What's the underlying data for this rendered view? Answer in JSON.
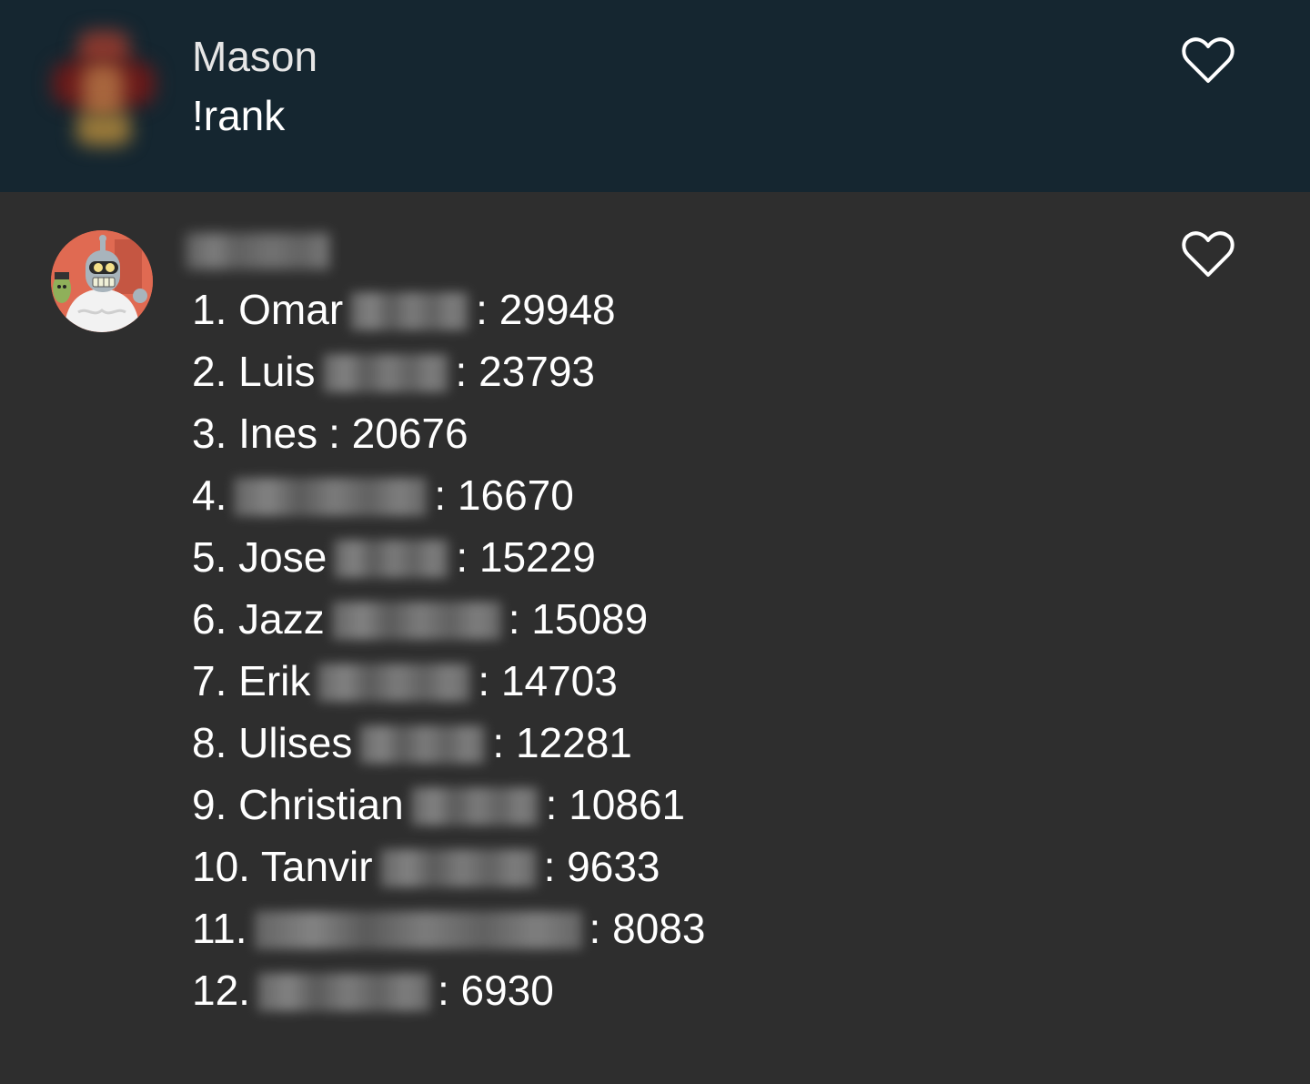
{
  "messages": [
    {
      "username": "Mason",
      "text": "!rank",
      "avatar_icon": "avatar-icon",
      "like_icon": "heart-outline-icon"
    },
    {
      "username": "",
      "avatar_icon": "bender-avatar-icon",
      "like_icon": "heart-outline-icon",
      "ranks": [
        {
          "label": "1. Omar",
          "score": ": 29948"
        },
        {
          "label": "2. Luis",
          "score": ": 23793"
        },
        {
          "label": "3. Ines",
          "score": ": 20676"
        },
        {
          "label": "4.",
          "score": ": 16670"
        },
        {
          "label": "5. Jose",
          "score": ": 15229"
        },
        {
          "label": "6. Jazz",
          "score": ": 15089"
        },
        {
          "label": "7. Erik",
          "score": ": 14703"
        },
        {
          "label": "8. Ulises",
          "score": ": 12281"
        },
        {
          "label": "9. Christian",
          "score": ": 10861"
        },
        {
          "label": "10. Tanvir",
          "score": ": 9633"
        },
        {
          "label": "11.",
          "score": ": 8083"
        },
        {
          "label": "12.",
          "score": ": 6930"
        }
      ]
    }
  ],
  "colors": {
    "top_message_bg": "#152630",
    "bottom_message_bg": "#2e2e2e",
    "text": "#ffffff"
  }
}
